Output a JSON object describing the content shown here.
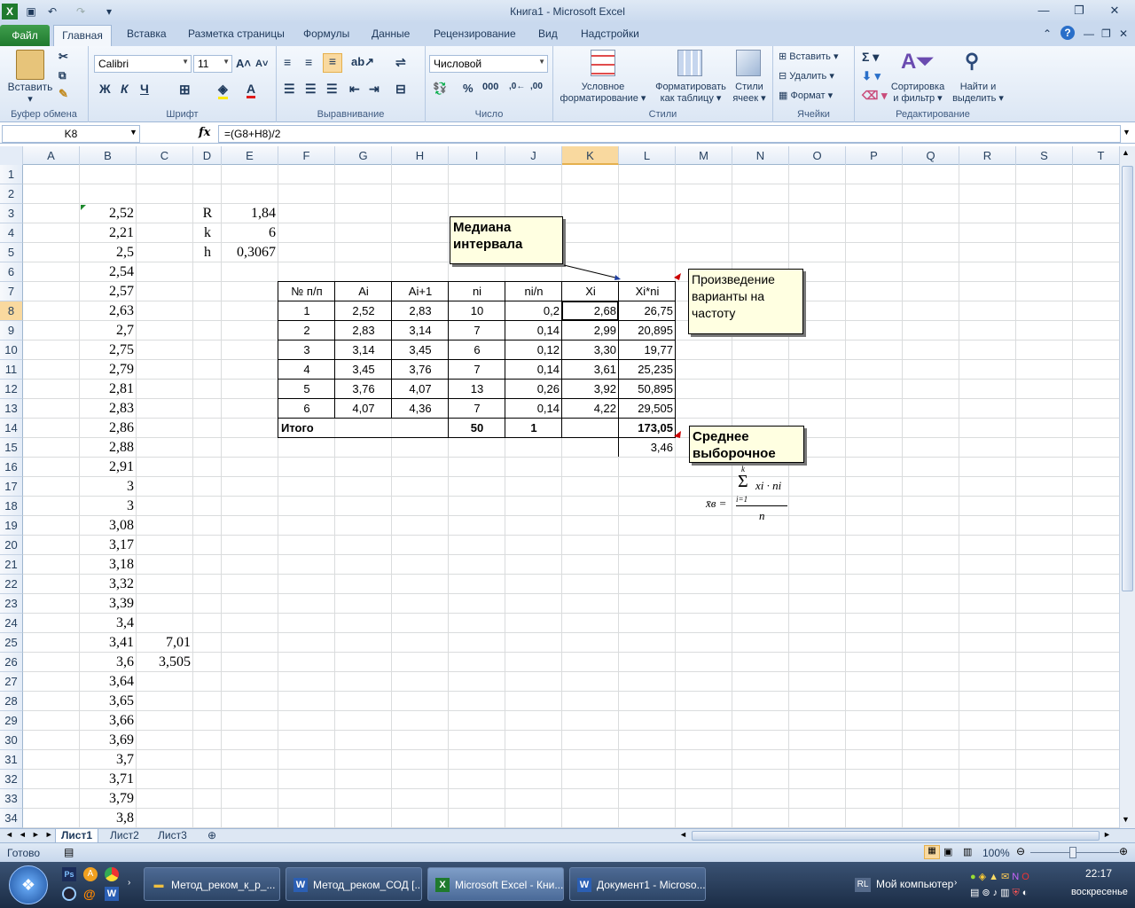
{
  "window": {
    "title": "Книга1  -  Microsoft Excel"
  },
  "ribbon_tabs": [
    "Файл",
    "Главная",
    "Вставка",
    "Разметка страницы",
    "Формулы",
    "Данные",
    "Рецензирование",
    "Вид",
    "Надстройки"
  ],
  "ribbon": {
    "clipboard": {
      "paste": "Вставить",
      "label": "Буфер обмена"
    },
    "font": {
      "name": "Calibri",
      "size": "11",
      "label": "Шрифт"
    },
    "alignment": {
      "label": "Выравнивание"
    },
    "number": {
      "format": "Числовой",
      "label": "Число"
    },
    "styles": {
      "cond": "Условное",
      "cond2": "форматирование",
      "table": "Форматировать",
      "table2": "как таблицу",
      "cell": "Стили",
      "cell2": "ячеек",
      "label": "Стили"
    },
    "cells": {
      "insert": "Вставить",
      "delete": "Удалить",
      "format": "Формат",
      "label": "Ячейки"
    },
    "editing": {
      "sort": "Сортировка",
      "sort2": "и фильтр",
      "find": "Найти и",
      "find2": "выделить",
      "label": "Редактирование"
    }
  },
  "formula_bar": {
    "name_box": "K8",
    "fx": "fx",
    "formula": "=(G8+H8)/2"
  },
  "columns": [
    "A",
    "B",
    "C",
    "D",
    "E",
    "F",
    "G",
    "H",
    "I",
    "J",
    "K",
    "L",
    "M",
    "N",
    "O",
    "P",
    "Q",
    "R",
    "S",
    "T"
  ],
  "rows": [
    "1",
    "2",
    "3",
    "4",
    "5",
    "6",
    "7",
    "8",
    "9",
    "10",
    "11",
    "12",
    "13",
    "14",
    "15",
    "16",
    "17",
    "18",
    "19",
    "20",
    "21",
    "22",
    "23",
    "24",
    "25",
    "26",
    "27",
    "28",
    "29",
    "30",
    "31",
    "32",
    "33",
    "34"
  ],
  "col_b": [
    "",
    "",
    "2,52",
    "2,21",
    "2,5",
    "2,54",
    "2,57",
    "2,63",
    "2,7",
    "2,75",
    "2,79",
    "2,81",
    "2,83",
    "2,86",
    "2,88",
    "2,91",
    "3",
    "3",
    "3,08",
    "3,17",
    "3,18",
    "3,32",
    "3,39",
    "3,4",
    "3,41",
    "3,6",
    "3,64",
    "3,65",
    "3,66",
    "3,69",
    "3,7",
    "3,71",
    "3,79",
    "3,8"
  ],
  "col_c": {
    "r25": "7,01",
    "r26": "3,505"
  },
  "params": [
    {
      "name": "R",
      "value": "1,84"
    },
    {
      "name": "k",
      "value": "6"
    },
    {
      "name": "h",
      "value": "0,3067"
    }
  ],
  "table": {
    "headers": [
      "№ п/п",
      "Ai",
      "Ai+1",
      "ni",
      "ni/n",
      "Xi",
      "Xi*ni"
    ],
    "rows": [
      [
        "1",
        "2,52",
        "2,83",
        "10",
        "0,2",
        "2,68",
        "26,75"
      ],
      [
        "2",
        "2,83",
        "3,14",
        "7",
        "0,14",
        "2,99",
        "20,895"
      ],
      [
        "3",
        "3,14",
        "3,45",
        "6",
        "0,12",
        "3,30",
        "19,77"
      ],
      [
        "4",
        "3,45",
        "3,76",
        "7",
        "0,14",
        "3,61",
        "25,235"
      ],
      [
        "5",
        "3,76",
        "4,07",
        "13",
        "0,26",
        "3,92",
        "50,895"
      ],
      [
        "6",
        "4,07",
        "4,36",
        "7",
        "0,14",
        "4,22",
        "29,505"
      ]
    ],
    "total": {
      "label": "Итого",
      "ni": "50",
      "nin": "1",
      "sum": "173,05"
    },
    "mean": "3,46"
  },
  "notes": {
    "median": "Медиана интервала",
    "product": "Произведение варианты на частоту",
    "mean": "Среднее выборочное"
  },
  "formula_image": {
    "lhs": "x̄в =",
    "top": "k",
    "sum": "Σ",
    "bottom": "i=1",
    "num": "xi · ni",
    "den": "n"
  },
  "sheets": [
    "Лист1",
    "Лист2",
    "Лист3"
  ],
  "status": {
    "ready": "Готово",
    "zoom": "100%"
  },
  "taskbar": {
    "tasks": [
      "Метод_реком_к_р_...",
      "Метод_реком_СОД [...",
      "Microsoft Excel - Кни...",
      "Документ1 - Microso..."
    ],
    "lang": "RL",
    "computer": "Мой компьютер",
    "time": "22:17",
    "day": "воскресенье"
  }
}
